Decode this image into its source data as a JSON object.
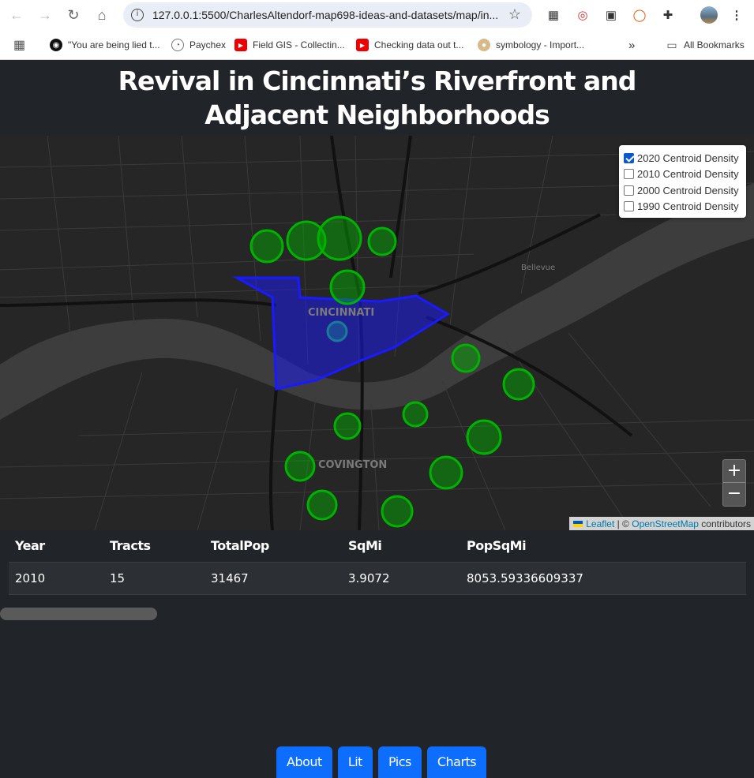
{
  "browser": {
    "url": "127.0.0.1:5500/CharlesAltendorf-map698-ideas-and-datasets/map/in...",
    "bookmarks": [
      {
        "label": "\"You are being lied t...",
        "icon": "eye-icon"
      },
      {
        "label": "Paychex",
        "icon": "paychex-icon"
      },
      {
        "label": "Field GIS - Collectin...",
        "icon": "youtube-icon"
      },
      {
        "label": "Checking data out t...",
        "icon": "youtube-icon"
      },
      {
        "label": "symbology - Import...",
        "icon": "symbology-icon"
      }
    ],
    "overflow_label": "»",
    "all_bookmarks_label": "All Bookmarks"
  },
  "page": {
    "title_line1": "Revival in Cincinnati’s Riverfront and",
    "title_line2": "Adjacent Neighborhoods"
  },
  "map": {
    "labels": {
      "cincinnati": "CINCINNATI",
      "covington": "COVINGTON",
      "bellevue": "Bellevue"
    },
    "layers": [
      {
        "label": "2020 Centroid Density",
        "checked": true
      },
      {
        "label": "2010 Centroid Density",
        "checked": false
      },
      {
        "label": "2000 Centroid Density",
        "checked": false
      },
      {
        "label": "1990 Centroid Density",
        "checked": false
      }
    ],
    "zoom_in": "+",
    "zoom_out": "−",
    "attribution": {
      "leaflet": "Leaflet",
      "separator": " | © ",
      "osm": "OpenStreetMap",
      "suffix": " contributors"
    },
    "colors": {
      "circles": "#00b300",
      "polygon": "#1a1aff"
    }
  },
  "table": {
    "headers": [
      "Year",
      "Tracts",
      "TotalPop",
      "SqMi",
      "PopSqMi"
    ],
    "rows": [
      [
        "2010",
        "15",
        "31467",
        "3.9072",
        "8053.59336609337"
      ]
    ]
  },
  "nav": [
    "About",
    "Lit",
    "Pics",
    "Charts"
  ]
}
